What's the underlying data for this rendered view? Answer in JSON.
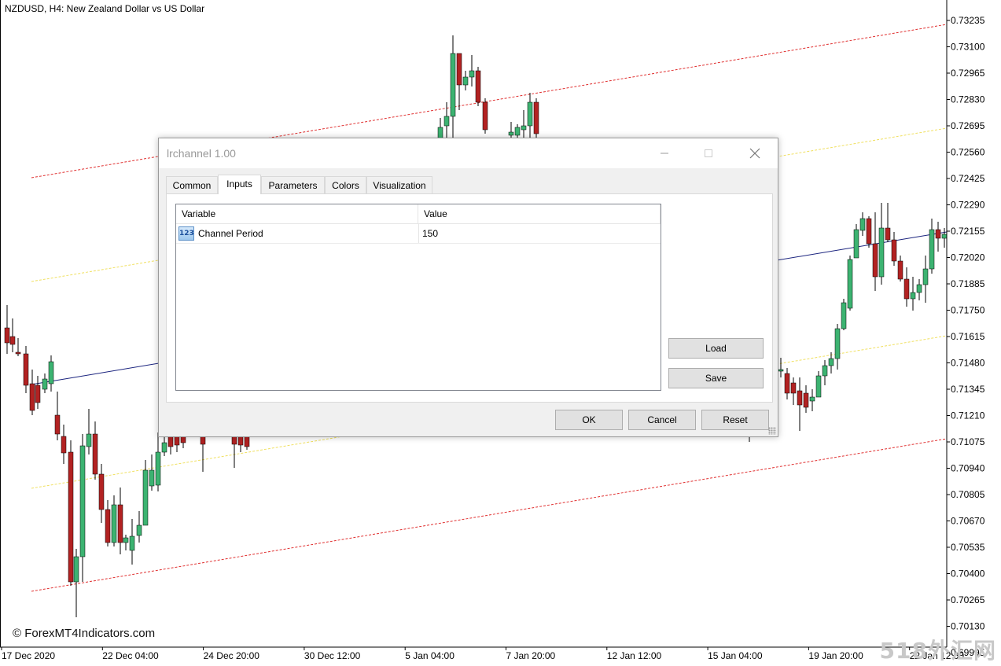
{
  "chart": {
    "title": "NZDUSD, H4:  New Zealand Dollar vs US Dollar",
    "copyright": "© ForexMT4Indicators.com",
    "watermark": "518外汇网",
    "price_labels": [
      "0.73235",
      "0.73100",
      "0.72965",
      "0.72830",
      "0.72695",
      "0.72560",
      "0.72425",
      "0.72290",
      "0.72155",
      "0.72020",
      "0.71885",
      "0.71750",
      "0.71615",
      "0.71480",
      "0.71345",
      "0.71210",
      "0.71075",
      "0.70940",
      "0.70805",
      "0.70670",
      "0.70535",
      "0.70400",
      "0.70265",
      "0.70130",
      "0.69995"
    ],
    "time_labels": [
      "17 Dec 2020",
      "22 Dec 04:00",
      "24 Dec 20:00",
      "30 Dec 12:00",
      "5 Jan 04:00",
      "7 Jan 20:00",
      "12 Jan 12:00",
      "15 Jan 04:00",
      "19 Jan 20:00",
      "22 Jan 12:00"
    ],
    "colors": {
      "bull": "#3cb371",
      "bear": "#b22222",
      "outer_channel": "#e03030",
      "inner_channel": "#f0e060",
      "regression_line": "#1a237e",
      "grid_axis": "#000000"
    }
  },
  "dialog": {
    "title": "lrchannel 1.00",
    "tabs": [
      {
        "label": "Common",
        "active": false
      },
      {
        "label": "Inputs",
        "active": true
      },
      {
        "label": "Parameters",
        "active": false
      },
      {
        "label": "Colors",
        "active": false
      },
      {
        "label": "Visualization",
        "active": false
      }
    ],
    "columns": {
      "variable": "Variable",
      "value": "Value"
    },
    "rows": [
      {
        "icon": "number-123-icon",
        "icon_text": "123",
        "variable": "Channel Period",
        "value": "150"
      }
    ],
    "buttons": {
      "load": "Load",
      "save": "Save",
      "ok": "OK",
      "cancel": "Cancel",
      "reset": "Reset"
    }
  }
}
